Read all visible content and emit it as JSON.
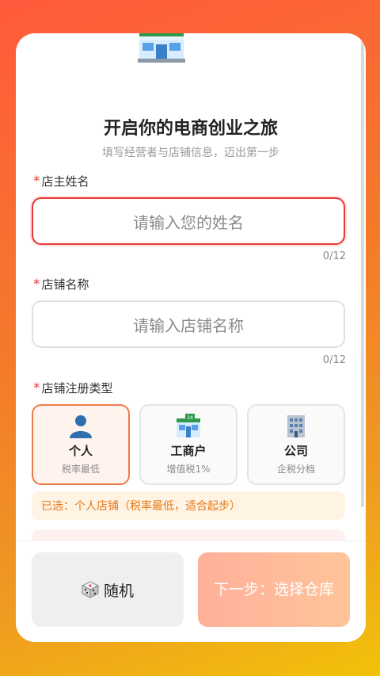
{
  "header": {
    "title": "开启你的电商创业之旅",
    "subtitle": "填写经营者与店铺信息，迈出第一步",
    "hero_icon": "convenience-store-icon"
  },
  "form": {
    "required_mark": "*",
    "owner_name": {
      "label": "店主姓名",
      "placeholder": "请输入您的姓名",
      "value": "",
      "counter": "0/12"
    },
    "shop_name": {
      "label": "店铺名称",
      "placeholder": "请输入店铺名称",
      "value": "",
      "counter": "0/12"
    },
    "shop_type": {
      "label": "店铺注册类型",
      "options": [
        {
          "name": "个人",
          "desc": "税率最低",
          "icon": "person-icon",
          "selected": true
        },
        {
          "name": "工商户",
          "desc": "增值税1%",
          "icon": "store-24-icon",
          "selected": false
        },
        {
          "name": "公司",
          "desc": "企税分档",
          "icon": "office-building-icon",
          "selected": false
        }
      ],
      "selected_note": "已选：个人店铺（税率最低，适合起步）"
    }
  },
  "footer": {
    "random_label": "随机",
    "random_icon": "dice-icon",
    "next_label": "下一步：选择仓库"
  },
  "colors": {
    "error_red": "#e53935",
    "accent_orange": "#f07a4a",
    "note_text": "#e57a1a"
  }
}
